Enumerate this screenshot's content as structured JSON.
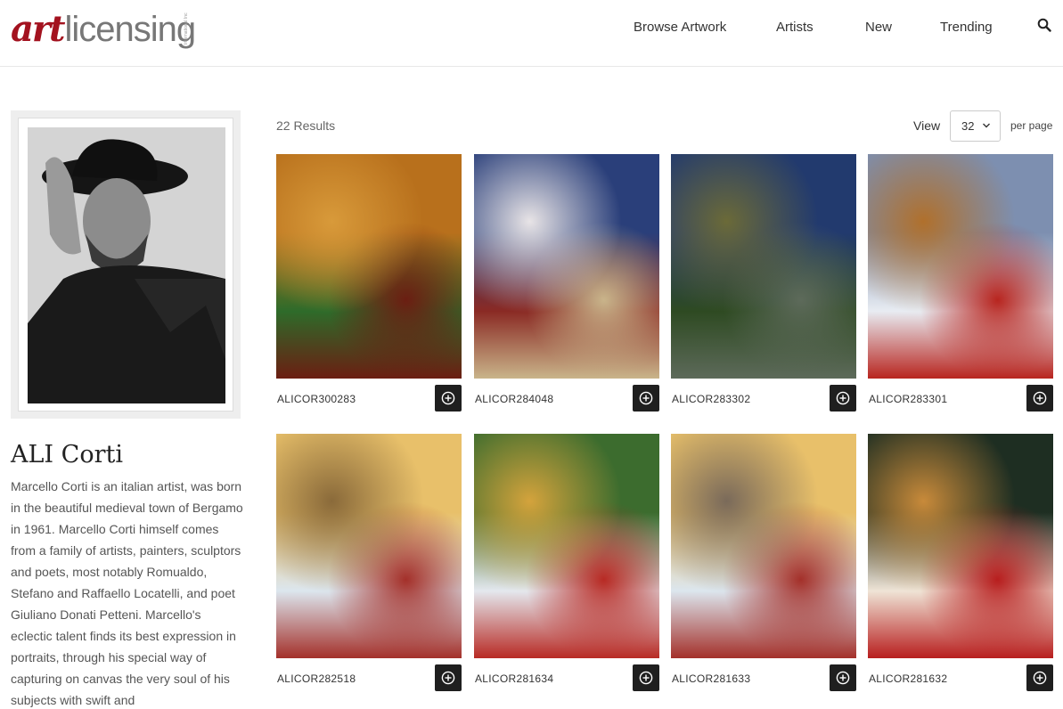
{
  "header": {
    "logo_art": "art",
    "logo_licensing": "licensing",
    "logo_tm": "International Inc",
    "nav": [
      "Browse Artwork",
      "Artists",
      "New",
      "Trending"
    ],
    "search_icon": "search-icon"
  },
  "artist": {
    "name": "ALI Corti",
    "bio": "Marcello Corti is an italian artist, was born in the beautiful medieval town of Bergamo in 1961. Marcello Corti himself comes from a family of artists, painters, sculptors and poets, most notably Romualdo, Stefano and Raffaello Locatelli, and poet Giuliano Donati Petteni. Marcello's eclectic talent finds its best expression in portraits, through his special way of capturing on canvas the very soul of his subjects with swift and"
  },
  "results": {
    "count_label": "22 Results",
    "view_label": "View",
    "per_page_value": "32",
    "per_page_label": "per page"
  },
  "artworks": [
    {
      "code": "ALICOR300283",
      "colors": [
        "#b8701c",
        "#6b1e12",
        "#2e6b2a",
        "#d89a3a"
      ]
    },
    {
      "code": "ALICOR284048",
      "colors": [
        "#2a3f7a",
        "#c9b48a",
        "#8a2a24",
        "#e8e4e6"
      ]
    },
    {
      "code": "ALICOR283302",
      "colors": [
        "#223a6e",
        "#5d6a5a",
        "#2e4a22",
        "#6b6a38"
      ]
    },
    {
      "code": "ALICOR283301",
      "colors": [
        "#7d8fb0",
        "#b8251f",
        "#e8ecf2",
        "#b0702c"
      ]
    },
    {
      "code": "ALICOR282518",
      "colors": [
        "#e8c06a",
        "#a4302a",
        "#dce6ee",
        "#8a6a3a"
      ]
    },
    {
      "code": "ALICOR281634",
      "colors": [
        "#3c6c2e",
        "#b82a24",
        "#e4e8ee",
        "#d4a33c"
      ]
    },
    {
      "code": "ALICOR281633",
      "colors": [
        "#e8c06a",
        "#a4302a",
        "#dce6ee",
        "#7a6a5a"
      ]
    },
    {
      "code": "ALICOR281632",
      "colors": [
        "#1e2e22",
        "#b81e1e",
        "#efe4d6",
        "#c88a3a"
      ]
    }
  ]
}
